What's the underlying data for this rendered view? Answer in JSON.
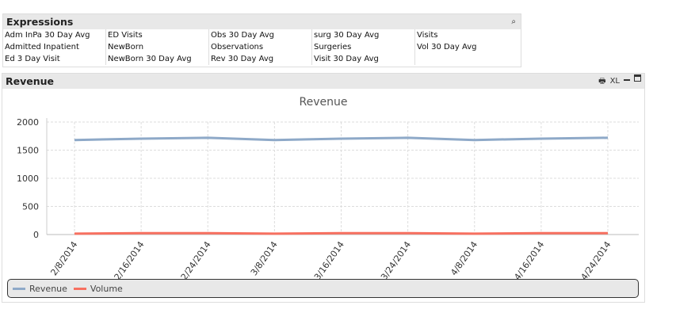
{
  "expressions": {
    "title": "Expressions",
    "search_icon": "magnifier-icon",
    "columns": [
      [
        "Adm InPa 30 Day Avg",
        "Admitted Inpatient",
        "Ed 3 Day Visit"
      ],
      [
        "ED Visits",
        "NewBorn",
        "NewBorn 30 Day Avg"
      ],
      [
        "Obs 30 Day Avg",
        "Observations",
        "Rev 30 Day Avg"
      ],
      [
        "surg 30 Day Avg",
        "Surgeries",
        "Visit 30 Day Avg"
      ],
      [
        "Visits",
        "Vol 30 Day Avg"
      ]
    ]
  },
  "revenue_box": {
    "title": "Revenue",
    "icons": {
      "print": "print-icon",
      "xl": "XL",
      "minimize": "minimize-icon",
      "maximize": "maximize-icon"
    }
  },
  "chart_data": {
    "type": "line",
    "title": "Revenue",
    "categories": [
      "2/8/2014",
      "2/16/2014",
      "2/24/2014",
      "3/8/2014",
      "3/16/2014",
      "3/24/2014",
      "4/8/2014",
      "4/16/2014",
      "4/24/2014"
    ],
    "series": [
      {
        "name": "Revenue",
        "color": "#8ea9c8",
        "values": [
          1680,
          1705,
          1720,
          1680,
          1705,
          1720,
          1680,
          1705,
          1720
        ]
      },
      {
        "name": "Volume",
        "color": "#f77060",
        "values": [
          15,
          25,
          25,
          15,
          25,
          25,
          15,
          25,
          25
        ]
      }
    ],
    "ylim": [
      0,
      2000
    ],
    "yticks": [
      0,
      500,
      1000,
      1500,
      2000
    ],
    "grid": true,
    "legend": "bottom"
  }
}
